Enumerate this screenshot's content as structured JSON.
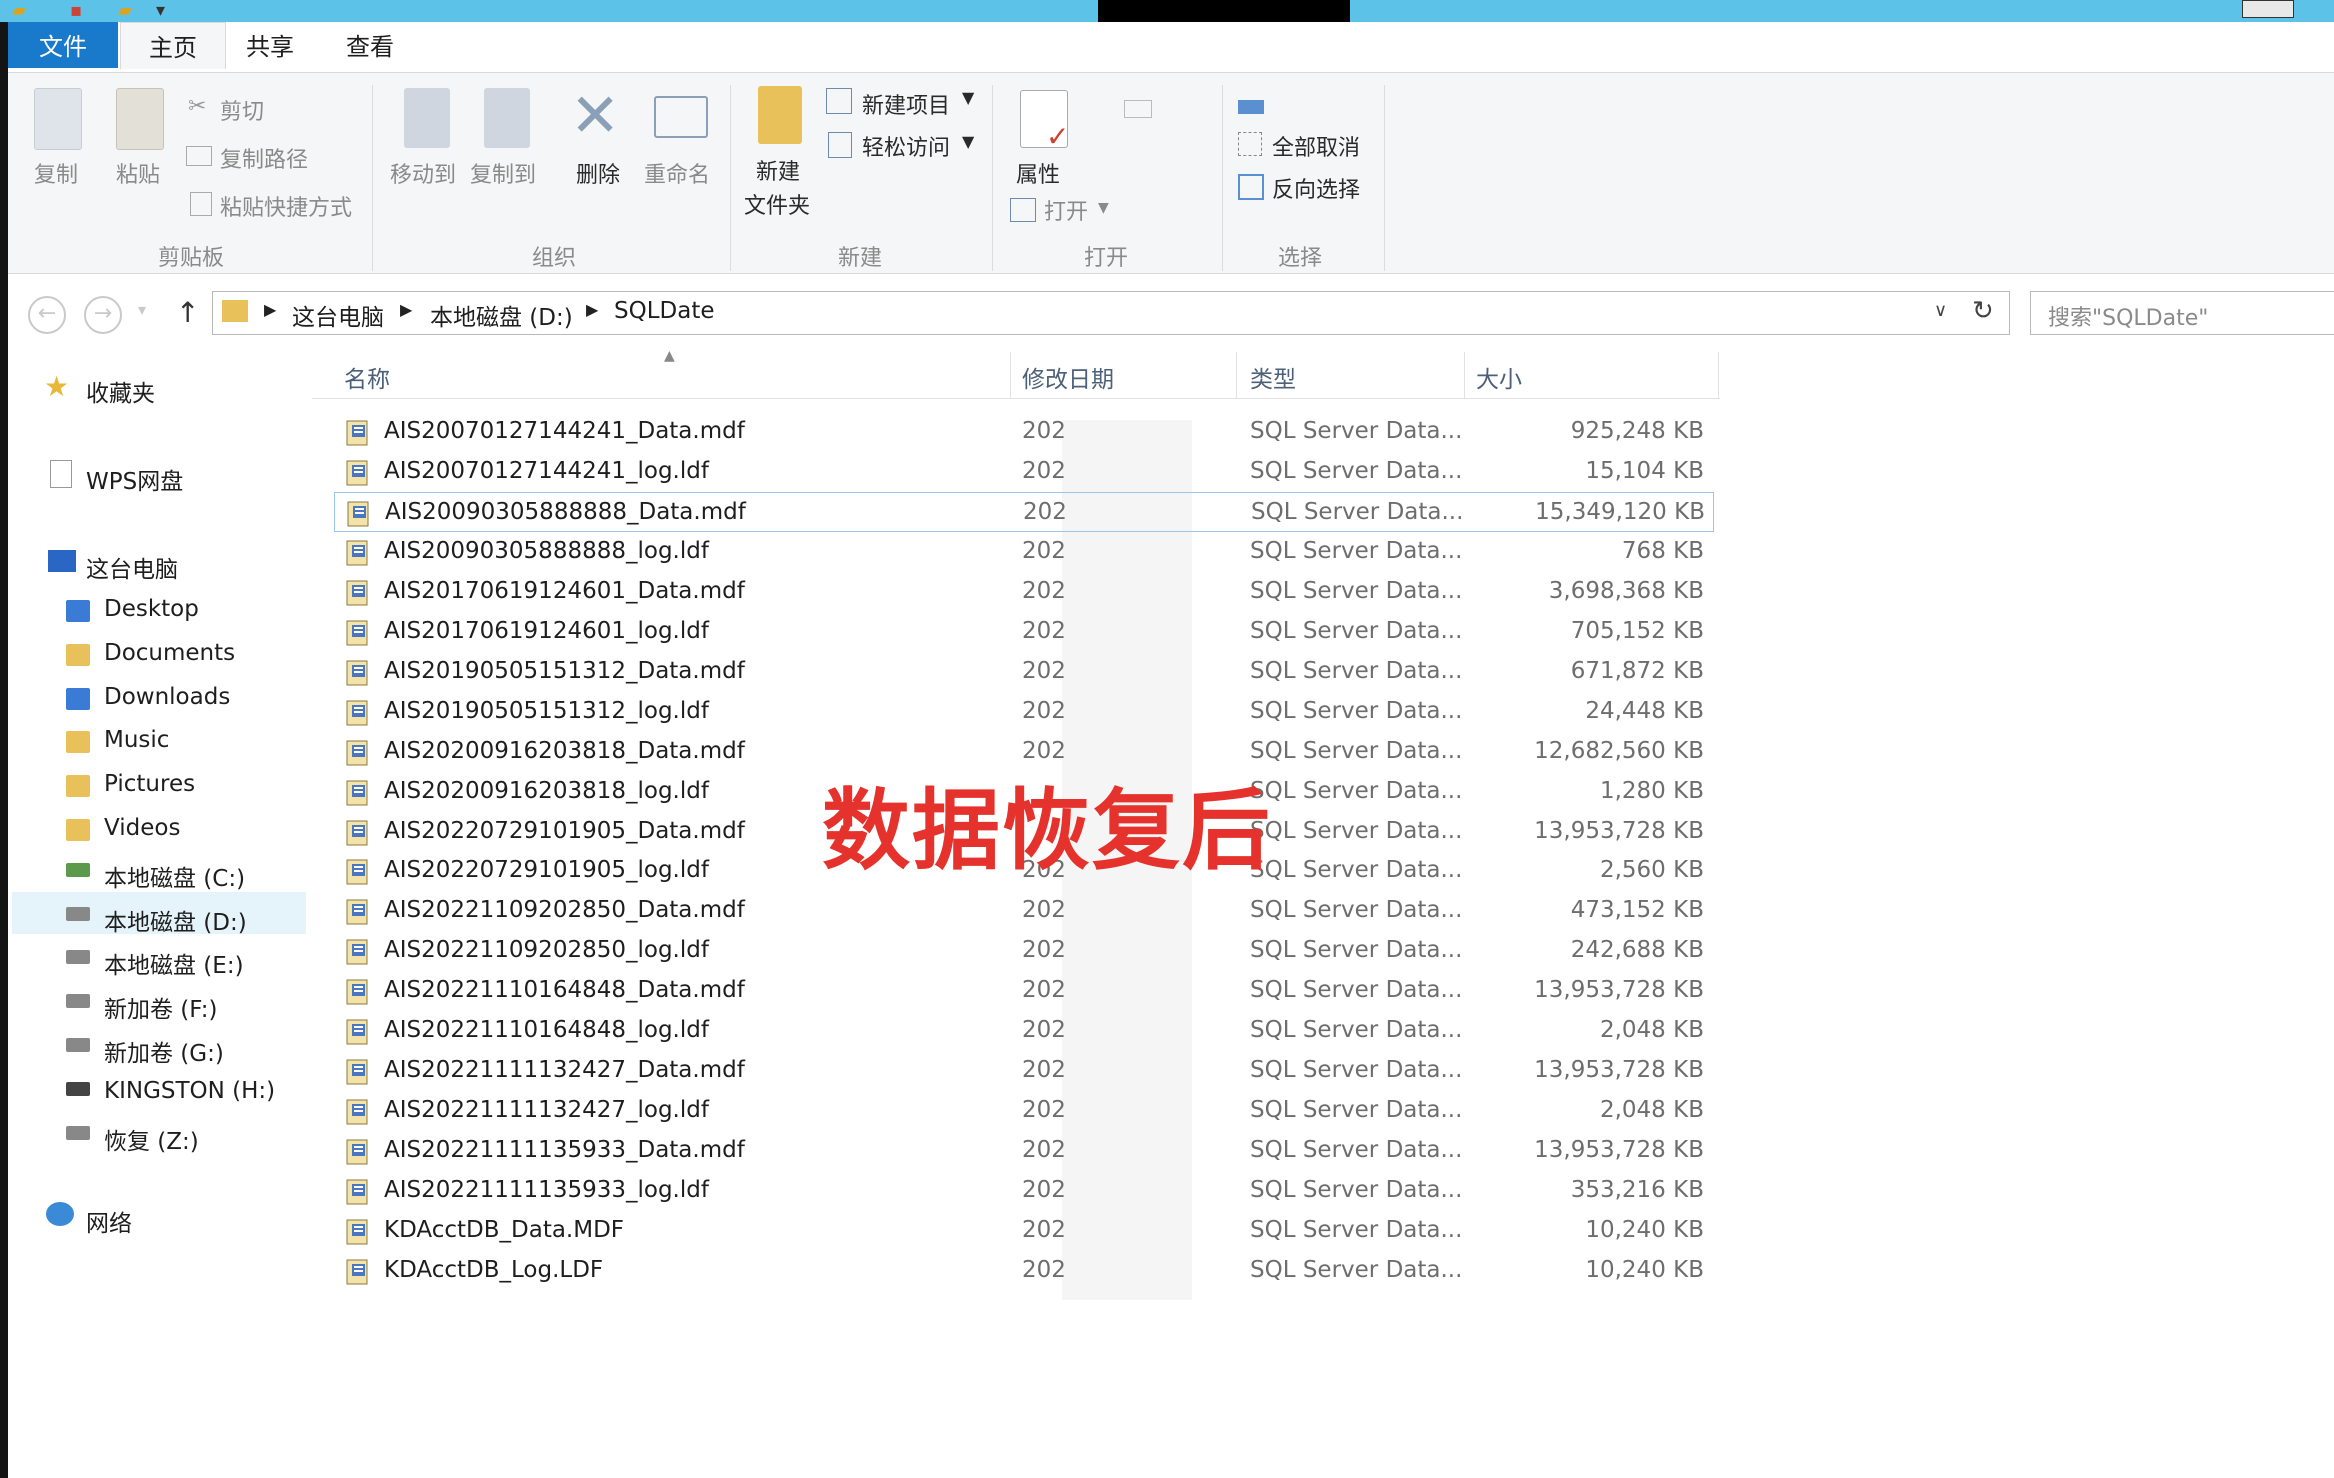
{
  "ribbon": {
    "tabs": {
      "file": "文件",
      "home": "主页",
      "share": "共享",
      "view": "查看"
    },
    "clipboard": {
      "copy": "复制",
      "paste": "粘贴",
      "cut": "剪切",
      "copy_path": "复制路径",
      "paste_shortcut": "粘贴快捷方式",
      "group": "剪贴板"
    },
    "organize": {
      "move_to": "移动到",
      "copy_to": "复制到",
      "delete": "删除",
      "rename": "重命名",
      "group": "组织"
    },
    "new": {
      "new_folder_line1": "新建",
      "new_folder_line2": "文件夹",
      "new_item": "新建项目",
      "easy_access": "轻松访问",
      "group": "新建"
    },
    "open": {
      "properties": "属性",
      "open": "打开",
      "group": "打开"
    },
    "select": {
      "select_none": "全部取消",
      "invert": "反向选择",
      "group": "选择"
    }
  },
  "address": {
    "crumbs": [
      "这台电脑",
      "本地磁盘 (D:)",
      "SQLDate"
    ],
    "search_placeholder": "搜索\"SQLDate\""
  },
  "nav": {
    "favorites": "收藏夹",
    "wps": "WPS网盘",
    "this_pc": "这台电脑",
    "items": [
      "Desktop",
      "Documents",
      "Downloads",
      "Music",
      "Pictures",
      "Videos",
      "本地磁盘 (C:)",
      "本地磁盘 (D:)",
      "本地磁盘 (E:)",
      "新加卷 (F:)",
      "新加卷 (G:)",
      "KINGSTON (H:)",
      "恢复 (Z:)"
    ],
    "network": "网络"
  },
  "columns": {
    "name": "名称",
    "date": "修改日期",
    "type": "类型",
    "size": "大小"
  },
  "files": [
    {
      "name": "AIS20070127144241_Data.mdf",
      "date": "202",
      "type": "SQL Server Data...",
      "size": "925,248 KB"
    },
    {
      "name": "AIS20070127144241_log.ldf",
      "date": "202",
      "type": "SQL Server Data...",
      "size": "15,104 KB"
    },
    {
      "name": "AIS20090305888888_Data.mdf",
      "date": "202",
      "type": "SQL Server Data...",
      "size": "15,349,120 KB"
    },
    {
      "name": "AIS20090305888888_log.ldf",
      "date": "202",
      "type": "SQL Server Data...",
      "size": "768 KB"
    },
    {
      "name": "AIS20170619124601_Data.mdf",
      "date": "202",
      "type": "SQL Server Data...",
      "size": "3,698,368 KB"
    },
    {
      "name": "AIS20170619124601_log.ldf",
      "date": "202",
      "type": "SQL Server Data...",
      "size": "705,152 KB"
    },
    {
      "name": "AIS20190505151312_Data.mdf",
      "date": "202",
      "type": "SQL Server Data...",
      "size": "671,872 KB"
    },
    {
      "name": "AIS20190505151312_log.ldf",
      "date": "202",
      "type": "SQL Server Data...",
      "size": "24,448 KB"
    },
    {
      "name": "AIS20200916203818_Data.mdf",
      "date": "202",
      "type": "SQL Server Data...",
      "size": "12,682,560 KB"
    },
    {
      "name": "AIS20200916203818_log.ldf",
      "date": "",
      "type": "SQL Server Data...",
      "size": "1,280 KB"
    },
    {
      "name": "AIS20220729101905_Data.mdf",
      "date": "",
      "type": "SQL Server Data...",
      "size": "13,953,728 KB"
    },
    {
      "name": "AIS20220729101905_log.ldf",
      "date": "202",
      "type": "SQL Server Data...",
      "size": "2,560 KB"
    },
    {
      "name": "AIS20221109202850_Data.mdf",
      "date": "202",
      "type": "SQL Server Data...",
      "size": "473,152 KB"
    },
    {
      "name": "AIS20221109202850_log.ldf",
      "date": "202",
      "type": "SQL Server Data...",
      "size": "242,688 KB"
    },
    {
      "name": "AIS20221110164848_Data.mdf",
      "date": "202",
      "type": "SQL Server Data...",
      "size": "13,953,728 KB"
    },
    {
      "name": "AIS20221110164848_log.ldf",
      "date": "202",
      "type": "SQL Server Data...",
      "size": "2,048 KB"
    },
    {
      "name": "AIS20221111132427_Data.mdf",
      "date": "202",
      "type": "SQL Server Data...",
      "size": "13,953,728 KB"
    },
    {
      "name": "AIS20221111132427_log.ldf",
      "date": "202",
      "type": "SQL Server Data...",
      "size": "2,048 KB"
    },
    {
      "name": "AIS20221111135933_Data.mdf",
      "date": "202",
      "type": "SQL Server Data...",
      "size": "13,953,728 KB"
    },
    {
      "name": "AIS20221111135933_log.ldf",
      "date": "202",
      "type": "SQL Server Data...",
      "size": "353,216 KB"
    },
    {
      "name": "KDAcctDB_Data.MDF",
      "date": "202",
      "type": "SQL Server Data...",
      "size": "10,240 KB"
    },
    {
      "name": "KDAcctDB_Log.LDF",
      "date": "202",
      "type": "SQL Server Data...",
      "size": "10,240 KB"
    }
  ],
  "selected_index": 2,
  "watermark": "数据恢复后",
  "colors": {
    "accent": "#1979ca",
    "titlebar": "#5cc2e8",
    "watermark": "#e6322c",
    "selection": "#e5f3fb"
  }
}
